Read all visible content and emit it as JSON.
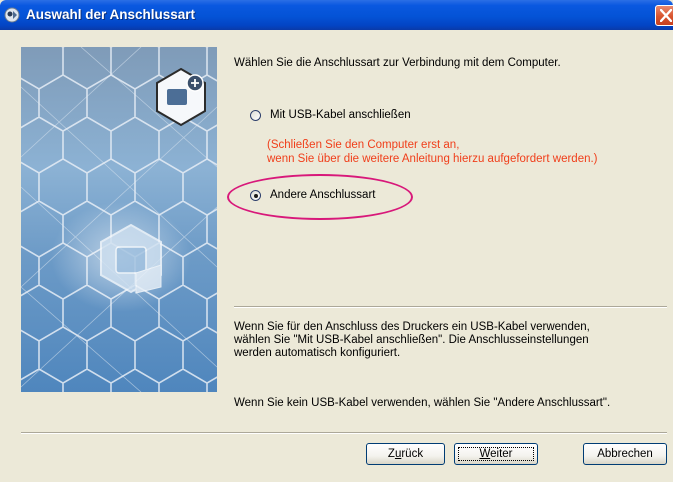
{
  "window": {
    "title": "Auswahl der Anschlussart"
  },
  "content": {
    "instruction": "Wählen Sie die Anschlussart zur Verbindung mit dem Computer.",
    "options": [
      {
        "label": "Mit USB-Kabel anschließen",
        "checked": false
      },
      {
        "label": "Andere Anschlussart",
        "checked": true
      }
    ],
    "note_line1": "(Schließen Sie den Computer erst an,",
    "note_line2": "wenn Sie über die weitere Anleitung hierzu aufgefordert werden.)",
    "info_line1": "Wenn Sie für den Anschluss des Druckers ein USB-Kabel verwenden,",
    "info_line2": "wählen Sie \"Mit USB-Kabel anschließen\". Die Anschlusseinstellungen",
    "info_line3": "werden automatisch konfiguriert.",
    "info_line4": "Wenn Sie kein USB-Kabel verwenden, wählen Sie \"Andere Anschlussart\"."
  },
  "buttons": {
    "back_first": "Z",
    "back_accel": "u",
    "back_rest": "rück",
    "next_accel": "W",
    "next_rest": "eiter",
    "cancel": "Abbrechen"
  },
  "colors": {
    "titlebar": "#0453d6",
    "note_text": "#f03e1a",
    "highlight_ellipse": "#d8187a",
    "dialog_background": "#ece9d8"
  },
  "icons": [
    "app-icon",
    "close-icon",
    "connection-icon",
    "printer-cube-icon"
  ]
}
